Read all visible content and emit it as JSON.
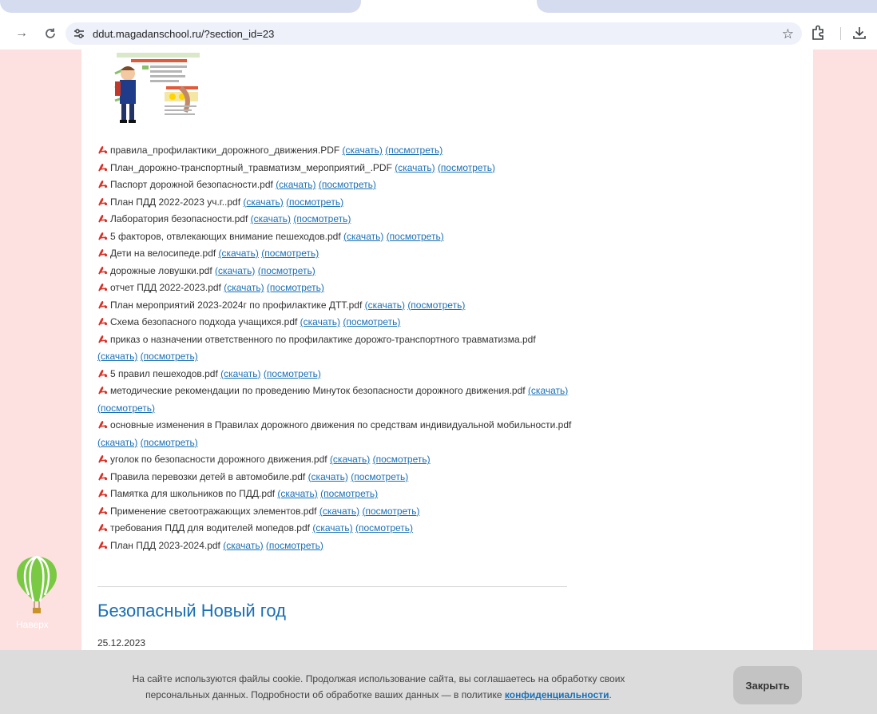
{
  "browser": {
    "url": "ddut.magadanschool.ru/?section_id=23"
  },
  "docs": [
    {
      "name": "правила_профилактики_дорожного_движения.PDF",
      "download": "(скачать)",
      "view": "(посмотреть)"
    },
    {
      "name": "План_дорожно-транспортный_травматизм_мероприятий_.PDF",
      "download": "(скачать)",
      "view": "(посмотреть)"
    },
    {
      "name": "Паспорт дорожной безопасности.pdf",
      "download": "(скачать)",
      "view": "(посмотреть)"
    },
    {
      "name": "План ПДД 2022-2023 уч.г..pdf",
      "download": "(скачать)",
      "view": "(посмотреть)"
    },
    {
      "name": "Лаборатория безопасности.pdf",
      "download": "(скачать)",
      "view": "(посмотреть)"
    },
    {
      "name": "5 факторов, отвлекающих внимание пешеходов.pdf",
      "download": "(скачать)",
      "view": "(посмотреть)"
    },
    {
      "name": "Дети на велосипеде.pdf",
      "download": "(скачать)",
      "view": "(посмотреть)"
    },
    {
      "name": "дорожные ловушки.pdf",
      "download": "(скачать)",
      "view": "(посмотреть)"
    },
    {
      "name": "отчет ПДД 2022-2023.pdf",
      "download": "(скачать)",
      "view": "(посмотреть)"
    },
    {
      "name": "План мероприятий 2023-2024г по профилактике ДТТ.pdf",
      "download": "(скачать)",
      "view": "(посмотреть)"
    },
    {
      "name": "Схема безопасного подхода учащихся.pdf",
      "download": "(скачать)",
      "view": "(посмотреть)"
    },
    {
      "name": "приказ о назначении ответственного по профилактике дорожго-транспортного травматизма.pdf",
      "download": "(скачать)",
      "view": "(посмотреть)"
    },
    {
      "name": "5 правил пешеходов.pdf",
      "download": "(скачать)",
      "view": "(посмотреть)"
    },
    {
      "name": "методические рекомендации по проведению Минуток безопасности дорожного движения.pdf",
      "download": "(скачать)",
      "view": "(посмотреть)"
    },
    {
      "name": "основные изменения в Правилах дорожного движения по средствам индивидуальной мобильности.pdf",
      "download": "(скачать)",
      "view": "(посмотреть)"
    },
    {
      "name": "уголок по безопасности дорожного движения.pdf",
      "download": "(скачать)",
      "view": "(посмотреть)"
    },
    {
      "name": "Правила перевозки детей в автомобиле.pdf",
      "download": "(скачать)",
      "view": "(посмотреть)"
    },
    {
      "name": "Памятка для школьников по ПДД.pdf",
      "download": "(скачать)",
      "view": "(посмотреть)"
    },
    {
      "name": "Применение светоотражающих элементов.pdf",
      "download": "(скачать)",
      "view": "(посмотреть)"
    },
    {
      "name": "требования ПДД для водителей мопедов.pdf",
      "download": "(скачать)",
      "view": "(посмотреть)"
    },
    {
      "name": "План ПДД 2023-2024.pdf",
      "download": "(скачать)",
      "view": "(посмотреть)"
    }
  ],
  "news": {
    "title": "Безопасный Новый год",
    "date": "25.12.2023"
  },
  "totop": {
    "label": "Наверх"
  },
  "cookie": {
    "text_before": "На сайте используются файлы cookie. Продолжая использование сайта, вы соглашаетесь на обработку своих персональных данных. Подробности об обработке ваших данных — в политике ",
    "link": "конфиденциальности",
    "text_after": ".",
    "close_label": "Закрыть"
  },
  "colors": {
    "page_bg": "#fde0e0",
    "link": "#1a6fb4",
    "cookie_bg": "#dcdcdc"
  }
}
